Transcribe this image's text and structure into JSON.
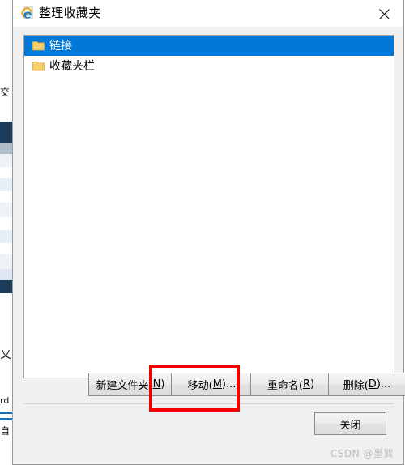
{
  "window": {
    "title": "整理收藏夹",
    "app_icon": "internet-explorer-icon",
    "close_icon": "close-icon"
  },
  "favorites_list": {
    "items": [
      {
        "label": "链接",
        "icon": "folder-icon",
        "selected": true
      },
      {
        "label": "收藏夹栏",
        "icon": "folder-icon",
        "selected": false
      }
    ]
  },
  "action_buttons": {
    "new_folder": {
      "text": "新建文件夹(",
      "accel": "N",
      "suffix": ")"
    },
    "move": {
      "text": "移动(",
      "accel": "M",
      "suffix": ")..."
    },
    "rename": {
      "text": "重命名(",
      "accel": "R",
      "suffix": ")"
    },
    "delete": {
      "text": "删除(",
      "accel": "D",
      "suffix": ")..."
    }
  },
  "footer": {
    "close_label": "关闭"
  },
  "annotation": {
    "target": "移动(M)...",
    "color": "#f50000"
  },
  "watermark": {
    "text": "CSDN @墨巽"
  },
  "colors": {
    "selection_blue": "#0078d7",
    "dialog_face": "#f0f0f0",
    "folder_yellow": "#f7cf6b",
    "annotation_red": "#f50000"
  },
  "background_page": {
    "visible_fragments": [
      "交",
      "又",
      "rd",
      "自"
    ]
  }
}
